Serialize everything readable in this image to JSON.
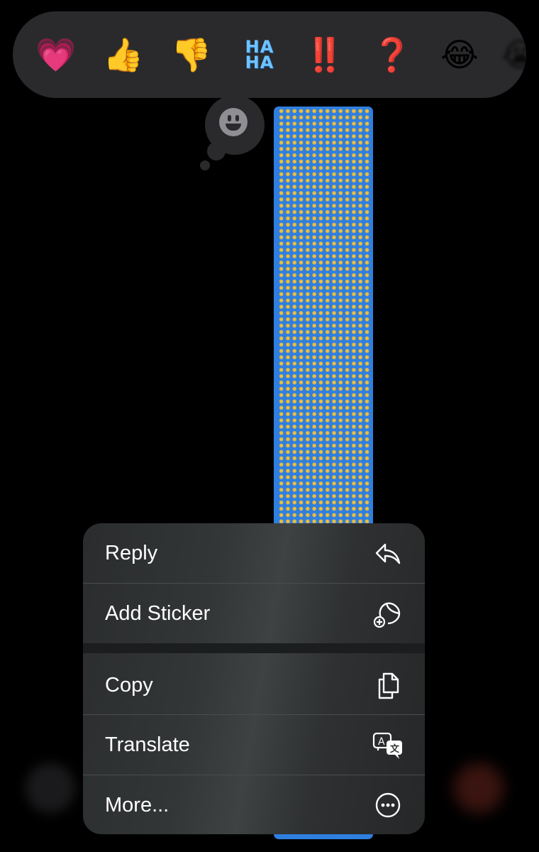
{
  "tapbacks": [
    {
      "name": "heart",
      "glyph": "💗"
    },
    {
      "name": "thumbs-up",
      "glyph": "👍"
    },
    {
      "name": "thumbs-down",
      "glyph": "👎"
    },
    {
      "name": "haha",
      "glyph_top": "HA",
      "glyph_bottom": "HA"
    },
    {
      "name": "exclamation",
      "glyph": "‼️"
    },
    {
      "name": "question",
      "glyph": "❓"
    },
    {
      "name": "laughing",
      "glyph": "😂"
    },
    {
      "name": "more-emoji",
      "glyph": "😭"
    }
  ],
  "message": {
    "bubble_color": "#2f7fe0",
    "content_glyph": "😄"
  },
  "context_menu": {
    "items": [
      {
        "label": "Reply",
        "icon": "reply-icon"
      },
      {
        "label": "Add Sticker",
        "icon": "add-sticker-icon"
      },
      {
        "label": "Copy",
        "icon": "copy-icon"
      },
      {
        "label": "Translate",
        "icon": "translate-icon"
      },
      {
        "label": "More...",
        "icon": "more-icon"
      }
    ]
  }
}
